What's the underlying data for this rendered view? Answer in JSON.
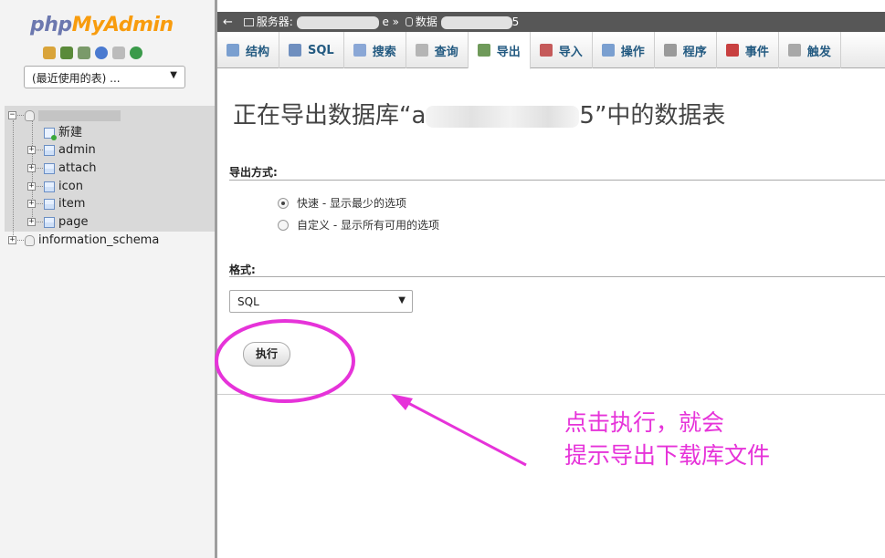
{
  "nav": {
    "logo_part1": "php",
    "logo_part2": "MyAdmin",
    "recent_select": "(最近使用的表) ...",
    "tree": {
      "new_label": "新建",
      "tables": [
        "admin",
        "attach",
        "icon",
        "item",
        "page"
      ],
      "other_db": "information_schema"
    }
  },
  "breadcrumb": {
    "server_label": "服务器:",
    "server_suffix": "e »",
    "db_label": "数据",
    "db_suffix": "5"
  },
  "tabs": [
    {
      "label": "结构",
      "icon": "structure-icon",
      "color": "#7a9fd0"
    },
    {
      "label": "SQL",
      "icon": "sql-icon",
      "color": "#6f8fbf"
    },
    {
      "label": "搜索",
      "icon": "search-icon",
      "color": "#8aa7d6"
    },
    {
      "label": "查询",
      "icon": "query-icon",
      "color": "#b5b5b5"
    },
    {
      "label": "导出",
      "icon": "export-icon",
      "color": "#6f9a5a",
      "active": true
    },
    {
      "label": "导入",
      "icon": "import-icon",
      "color": "#c55a5a"
    },
    {
      "label": "操作",
      "icon": "wrench-icon",
      "color": "#7a9fd0"
    },
    {
      "label": "程序",
      "icon": "routines-icon",
      "color": "#9a9a9a"
    },
    {
      "label": "事件",
      "icon": "clock-icon",
      "color": "#c84040"
    },
    {
      "label": "触发",
      "icon": "triggers-icon",
      "color": "#a8a8a8"
    }
  ],
  "main": {
    "title_prefix": "正在导出数据库“a",
    "title_suffix": "5”中的数据表",
    "export_method_label": "导出方式:",
    "radio_quick": "快速 - 显示最少的选项",
    "radio_custom": "自定义 - 显示所有可用的选项",
    "format_label": "格式:",
    "format_value": "SQL",
    "go_button": "执行"
  },
  "annotation": {
    "line1": "点击执行，就会",
    "line2": "提示导出下载库文件",
    "color": "#e633d9"
  }
}
